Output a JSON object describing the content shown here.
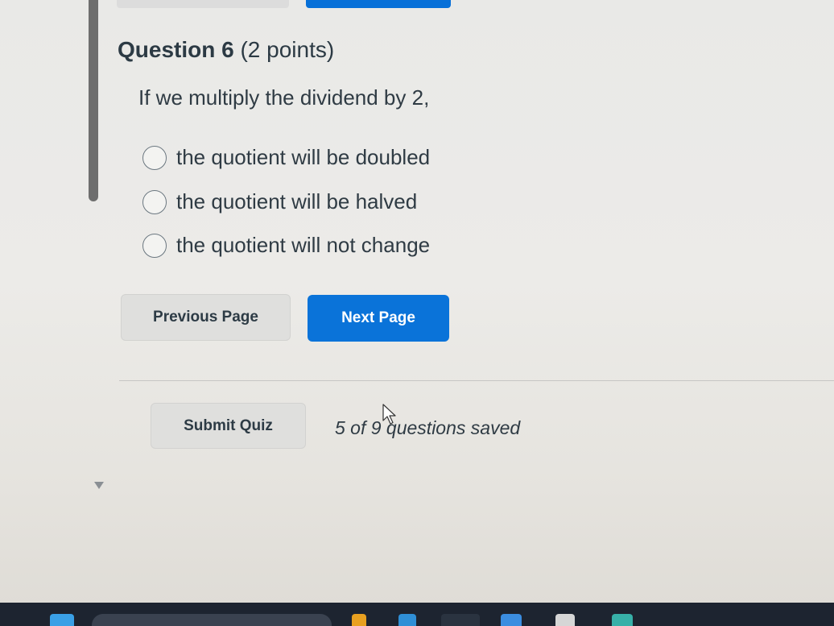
{
  "question": {
    "number_label": "Question 6",
    "points_label": "(2 points)",
    "prompt": "If we multiply the dividend  by 2,",
    "options": [
      {
        "label": "the quotient will be doubled"
      },
      {
        "label": "the quotient will be halved"
      },
      {
        "label": "the quotient will not change"
      }
    ]
  },
  "navigation": {
    "previous_label": "Previous Page",
    "next_label": "Next Page"
  },
  "footer": {
    "submit_label": "Submit Quiz",
    "saved_status": "5 of 9 questions saved"
  },
  "colors": {
    "primary_button": "#0a73d9",
    "secondary_button": "#dfdfdd",
    "text": "#2d3b45",
    "taskbar": "#1d2430"
  },
  "icons": [
    "radio-unselected-icon",
    "mouse-pointer-icon",
    "caret-down-icon"
  ]
}
